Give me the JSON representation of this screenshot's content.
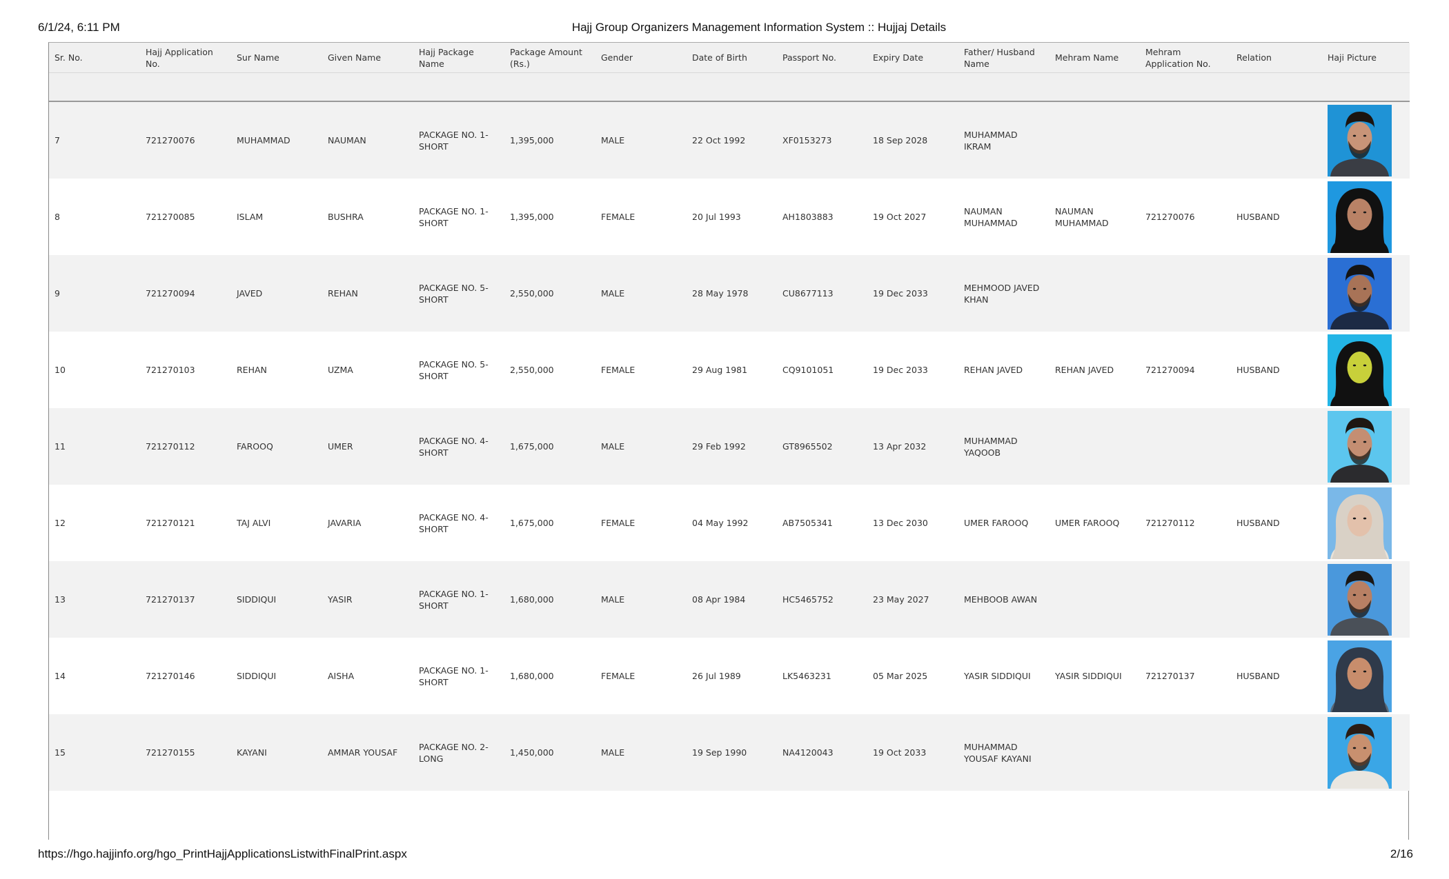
{
  "header": {
    "datetime": "6/1/24, 6:11 PM",
    "title": "Hajj Group Organizers Management Information System :: Hujjaj Details"
  },
  "footer": {
    "url": "https://hgo.hajjinfo.org/hgo_PrintHajjApplicationsListwithFinalPrint.aspx",
    "page": "2/16"
  },
  "columns": [
    "Sr. No.",
    "Hajj Application No.",
    "Sur Name",
    "Given Name",
    "Hajj Package Name",
    "Package Amount (Rs.)",
    "Gender",
    "Date of Birth",
    "Passport No.",
    "Expiry Date",
    "Father/ Husband Name",
    "Mehram Name",
    "Mehram Application No.",
    "Relation",
    "Haji Picture"
  ],
  "rows": [
    {
      "sr": "7",
      "app": "721270076",
      "sur": "MUHAMMAD",
      "given": "NAUMAN",
      "pkg": "PACKAGE NO. 1-SHORT",
      "amt": "1,395,000",
      "gender": "MALE",
      "dob": "22 Oct 1992",
      "passport": "XF0153273",
      "expiry": "18 Sep 2028",
      "father": "MUHAMMAD IKRAM",
      "mehram": "",
      "mehram_app": "",
      "relation": "",
      "photo": {
        "bg": "#1f93d6",
        "skin": "#c89478",
        "hair": "#1b1410",
        "cloth": "#3a3d44",
        "scarf": false
      }
    },
    {
      "sr": "8",
      "app": "721270085",
      "sur": "ISLAM",
      "given": "BUSHRA",
      "pkg": "PACKAGE NO. 1-SHORT",
      "amt": "1,395,000",
      "gender": "FEMALE",
      "dob": "20 Jul 1993",
      "passport": "AH1803883",
      "expiry": "19 Oct 2027",
      "father": "NAUMAN MUHAMMAD",
      "mehram": "NAUMAN MUHAMMAD",
      "mehram_app": "721270076",
      "relation": "HUSBAND",
      "photo": {
        "bg": "#1f98e0",
        "skin": "#b98266",
        "hair": "#111111",
        "cloth": "#111111",
        "scarf": true
      }
    },
    {
      "sr": "9",
      "app": "721270094",
      "sur": "JAVED",
      "given": "REHAN",
      "pkg": "PACKAGE NO. 5-SHORT",
      "amt": "2,550,000",
      "gender": "MALE",
      "dob": "28 May 1978",
      "passport": "CU8677113",
      "expiry": "19 Dec 2033",
      "father": "MEHMOOD JAVED KHAN",
      "mehram": "",
      "mehram_app": "",
      "relation": "",
      "photo": {
        "bg": "#2a6fd4",
        "skin": "#a87357",
        "hair": "#141414",
        "cloth": "#1c2a44",
        "scarf": false
      }
    },
    {
      "sr": "10",
      "app": "721270103",
      "sur": "REHAN",
      "given": "UZMA",
      "pkg": "PACKAGE NO. 5-SHORT",
      "amt": "2,550,000",
      "gender": "FEMALE",
      "dob": "29 Aug 1981",
      "passport": "CQ9101051",
      "expiry": "19 Dec 2033",
      "father": "REHAN JAVED",
      "mehram": "REHAN JAVED",
      "mehram_app": "721270094",
      "relation": "HUSBAND",
      "photo": {
        "bg": "#23b5e6",
        "skin": "#c8d03a",
        "hair": "#111111",
        "cloth": "#111111",
        "scarf": true
      }
    },
    {
      "sr": "11",
      "app": "721270112",
      "sur": "FAROOQ",
      "given": "UMER",
      "pkg": "PACKAGE NO. 4-SHORT",
      "amt": "1,675,000",
      "gender": "MALE",
      "dob": "29 Feb 1992",
      "passport": "GT8965502",
      "expiry": "13 Apr 2032",
      "father": "MUHAMMAD YAQOOB",
      "mehram": "",
      "mehram_app": "",
      "relation": "",
      "photo": {
        "bg": "#5cc6ee",
        "skin": "#c48e72",
        "hair": "#1e1712",
        "cloth": "#2b2b2e",
        "scarf": false
      }
    },
    {
      "sr": "12",
      "app": "721270121",
      "sur": "TAJ ALVI",
      "given": "JAVARIA",
      "pkg": "PACKAGE NO. 4-SHORT",
      "amt": "1,675,000",
      "gender": "FEMALE",
      "dob": "04 May 1992",
      "passport": "AB7505341",
      "expiry": "13 Dec 2030",
      "father": "UMER FAROOQ",
      "mehram": "UMER FAROOQ",
      "mehram_app": "721270112",
      "relation": "HUSBAND",
      "photo": {
        "bg": "#7ab8e8",
        "skin": "#e3c1ab",
        "hair": "#d9d1c6",
        "cloth": "#e8e2d8",
        "scarf": true
      }
    },
    {
      "sr": "13",
      "app": "721270137",
      "sur": "SIDDIQUI",
      "given": "YASIR",
      "pkg": "PACKAGE NO. 1-SHORT",
      "amt": "1,680,000",
      "gender": "MALE",
      "dob": "08 Apr 1984",
      "passport": "HC5465752",
      "expiry": "23 May 2027",
      "father": "MEHBOOB AWAN",
      "mehram": "",
      "mehram_app": "",
      "relation": "",
      "photo": {
        "bg": "#4a98dc",
        "skin": "#b88064",
        "hair": "#1b1714",
        "cloth": "#4a5058",
        "scarf": false
      }
    },
    {
      "sr": "14",
      "app": "721270146",
      "sur": "SIDDIQUI",
      "given": "AISHA",
      "pkg": "PACKAGE NO. 1-SHORT",
      "amt": "1,680,000",
      "gender": "FEMALE",
      "dob": "26 Jul 1989",
      "passport": "LK5463231",
      "expiry": "05 Mar 2025",
      "father": "YASIR SIDDIQUI",
      "mehram": "YASIR SIDDIQUI",
      "mehram_app": "721270137",
      "relation": "HUSBAND",
      "photo": {
        "bg": "#4aa3e4",
        "skin": "#c88d6c",
        "hair": "#2f3a4a",
        "cloth": "#5a6a7a",
        "scarf": true
      }
    },
    {
      "sr": "15",
      "app": "721270155",
      "sur": "KAYANI",
      "given": "AMMAR YOUSAF",
      "pkg": "PACKAGE NO. 2-LONG",
      "amt": "1,450,000",
      "gender": "MALE",
      "dob": "19 Sep 1990",
      "passport": "NA4120043",
      "expiry": "19 Oct 2033",
      "father": "MUHAMMAD YOUSAF KAYANI",
      "mehram": "",
      "mehram_app": "",
      "relation": "",
      "photo": {
        "bg": "#3aa6e6",
        "skin": "#c8906f",
        "hair": "#2a1c14",
        "cloth": "#e9e6e0",
        "scarf": false
      }
    }
  ]
}
